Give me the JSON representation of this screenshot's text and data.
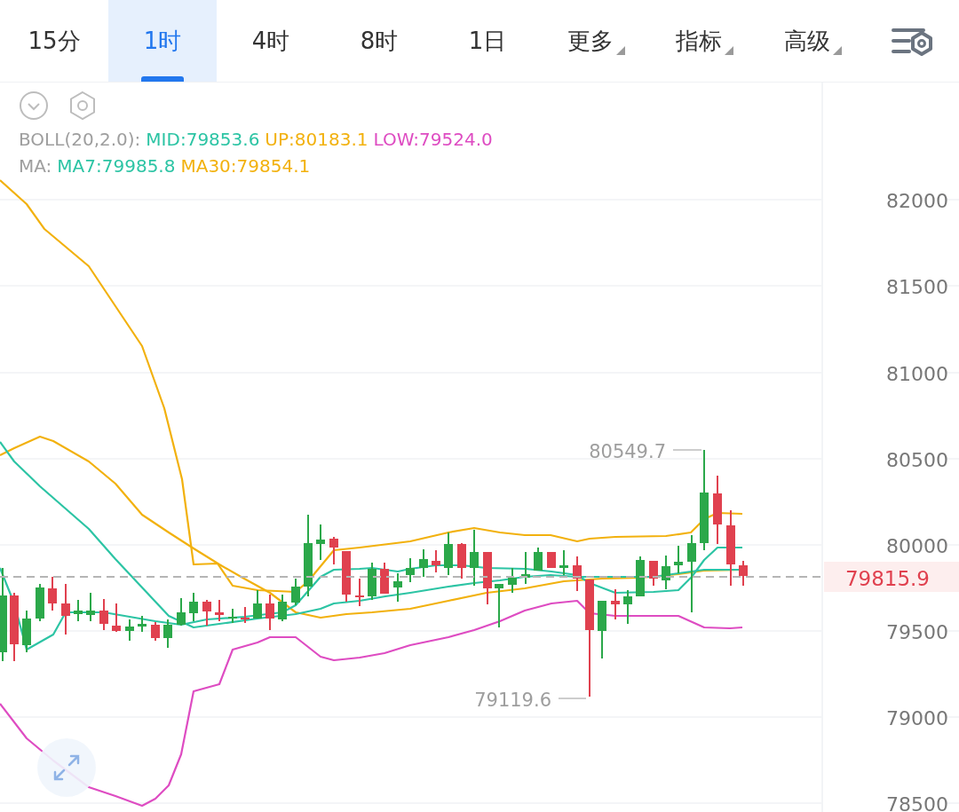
{
  "tabs": [
    {
      "label": "15分",
      "kind": "plain",
      "selected": false
    },
    {
      "label": "1时",
      "kind": "plain",
      "selected": true
    },
    {
      "label": "4时",
      "kind": "plain",
      "selected": false
    },
    {
      "label": "8时",
      "kind": "plain",
      "selected": false
    },
    {
      "label": "1日",
      "kind": "plain",
      "selected": false
    },
    {
      "label": "更多",
      "kind": "menu",
      "selected": false
    },
    {
      "label": "指标",
      "kind": "menu",
      "selected": false
    },
    {
      "label": "高级",
      "kind": "menu",
      "selected": false
    }
  ],
  "chart": {
    "legend": [
      {
        "items": [
          {
            "text": "BOLL(20,2.0):",
            "color": "#9e9e9e"
          },
          {
            "text": "MID:79853.6",
            "color": "#2cc4a4"
          },
          {
            "text": "UP:80183.1",
            "color": "#f2b10e"
          },
          {
            "text": "LOW:79524.0",
            "color": "#de4cc2"
          }
        ]
      },
      {
        "items": [
          {
            "text": "MA:",
            "color": "#9e9e9e"
          },
          {
            "text": "MA7:79985.8",
            "color": "#2cc4a4"
          },
          {
            "text": "MA30:79854.1",
            "color": "#f2b10e"
          }
        ]
      }
    ],
    "y_axis_labels": [
      "82000",
      "81500",
      "81000",
      "80500",
      "80000",
      "79500",
      "79000",
      "78500"
    ],
    "current_price": "79815.9",
    "high_marker": "80549.7",
    "low_marker": "79119.6"
  }
}
